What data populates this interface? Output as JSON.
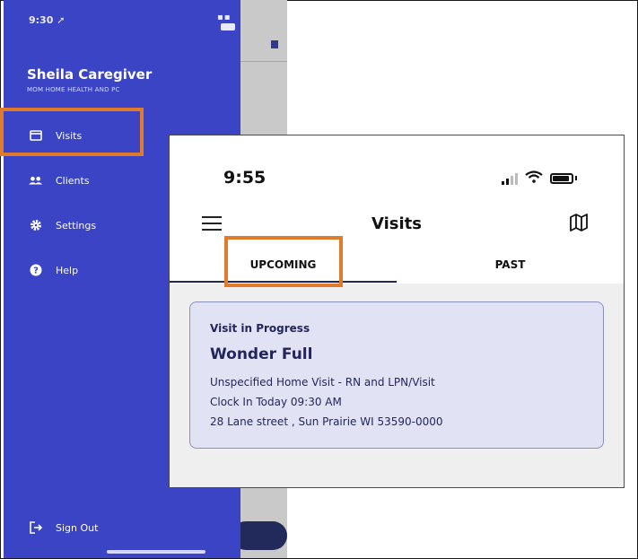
{
  "drawer": {
    "status_time": "9:30 ➚",
    "user_name": "Sheila Caregiver",
    "organization": "MOM HOME HEALTH AND PC",
    "menu": [
      {
        "label": "Visits",
        "icon": "calendar-icon"
      },
      {
        "label": "Clients",
        "icon": "people-icon"
      },
      {
        "label": "Settings",
        "icon": "gear-icon"
      },
      {
        "label": "Help",
        "icon": "help-icon"
      }
    ],
    "sign_out": {
      "label": "Sign Out",
      "icon": "sign-out-icon"
    }
  },
  "visits_screen": {
    "status_time": "9:55",
    "title": "Visits",
    "tabs": [
      {
        "label": "UPCOMING",
        "selected": true
      },
      {
        "label": "PAST",
        "selected": false
      }
    ],
    "visit_card": {
      "status": "Visit in Progress",
      "client_name": "Wonder Full",
      "service": "Unspecified Home Visit - RN and LPN/Visit",
      "clock_in": "Clock In Today 09:30 AM",
      "address": "28 Lane street , Sun Prairie WI 53590-0000"
    }
  },
  "colors": {
    "drawer_background": "#3a44c4",
    "highlight_outline": "#e07b2c",
    "card_background": "#e1e3f5",
    "card_text": "#23255e"
  }
}
